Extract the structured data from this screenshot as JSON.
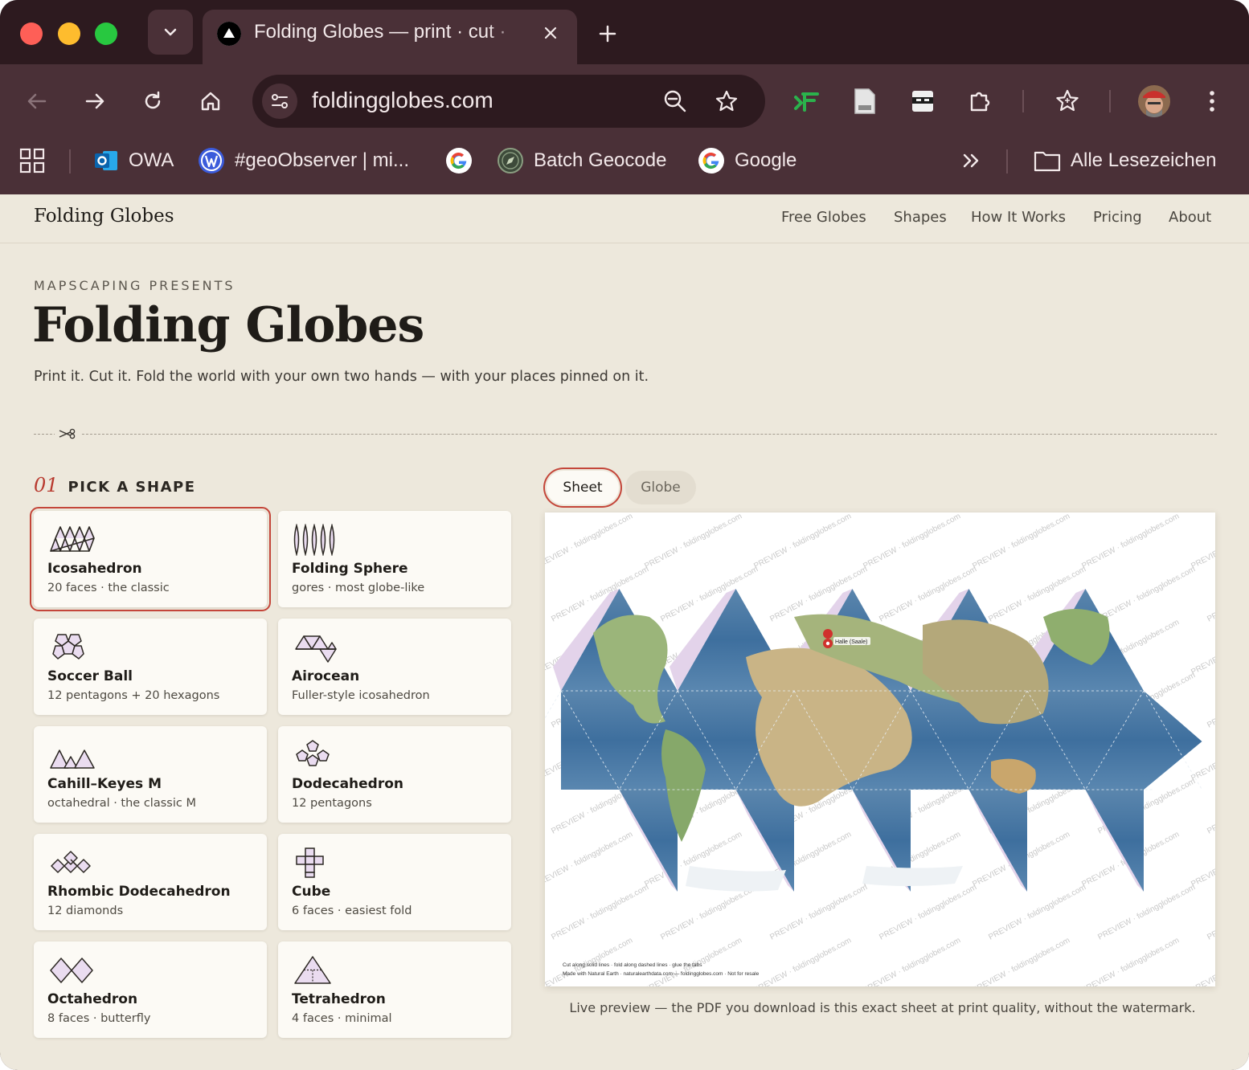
{
  "browser": {
    "tab_title": "Folding Globes — print · cut ·",
    "url": "foldingglobes.com",
    "bookmarks": [
      {
        "label": "OWA",
        "icon": "outlook-icon"
      },
      {
        "label": "#geoObserver | mi...",
        "icon": "wordpress-icon"
      },
      {
        "label": "",
        "icon": "google-icon"
      },
      {
        "label": "Batch Geocode",
        "icon": "compass-icon"
      },
      {
        "label": "Google",
        "icon": "google-icon"
      }
    ],
    "all_bookmarks": "Alle Lesezeichen",
    "colors": {
      "frame": "#2d1a1f",
      "toolbar": "#4a3037",
      "accent": "#c4463a"
    }
  },
  "site": {
    "brand": "Folding Globes",
    "nav": [
      "Free Globes",
      "Shapes",
      "How It Works",
      "Pricing",
      "About"
    ]
  },
  "hero": {
    "eyebrow": "MAPSCAPING PRESENTS",
    "title": "Folding Globes",
    "subtitle": "Print it. Cut it. Fold the world with your own two hands — with your places pinned on it."
  },
  "step": {
    "number": "01",
    "label": "PICK A SHAPE"
  },
  "shapes": [
    {
      "name": "Icosahedron",
      "desc": "20 faces · the classic",
      "selected": true
    },
    {
      "name": "Folding Sphere",
      "desc": "gores · most globe-like",
      "selected": false
    },
    {
      "name": "Soccer Ball",
      "desc": "12 pentagons + 20 hexagons",
      "selected": false
    },
    {
      "name": "Airocean",
      "desc": "Fuller-style icosahedron",
      "selected": false
    },
    {
      "name": "Cahill–Keyes M",
      "desc": "octahedral · the classic M",
      "selected": false
    },
    {
      "name": "Dodecahedron",
      "desc": "12 pentagons",
      "selected": false
    },
    {
      "name": "Rhombic Dodecahedron",
      "desc": "12 diamonds",
      "selected": false
    },
    {
      "name": "Cube",
      "desc": "6 faces · easiest fold",
      "selected": false
    },
    {
      "name": "Octahedron",
      "desc": "8 faces · butterfly",
      "selected": false
    },
    {
      "name": "Tetrahedron",
      "desc": "4 faces · minimal",
      "selected": false
    }
  ],
  "preview": {
    "tabs": [
      "Sheet",
      "Globe"
    ],
    "active_tab": "Sheet",
    "watermark": "PREVIEW · foldingglobes.com",
    "pin_label": "Halle (Saale)",
    "footer_line1": "Cut along solid lines · fold along dashed lines · glue the tabs",
    "footer_line2": "Made with Natural Earth · naturalearthdata.com — foldingglobes.com · Not for resale",
    "caption": "Live preview — the PDF you download is this exact sheet at print quality, without the watermark."
  }
}
